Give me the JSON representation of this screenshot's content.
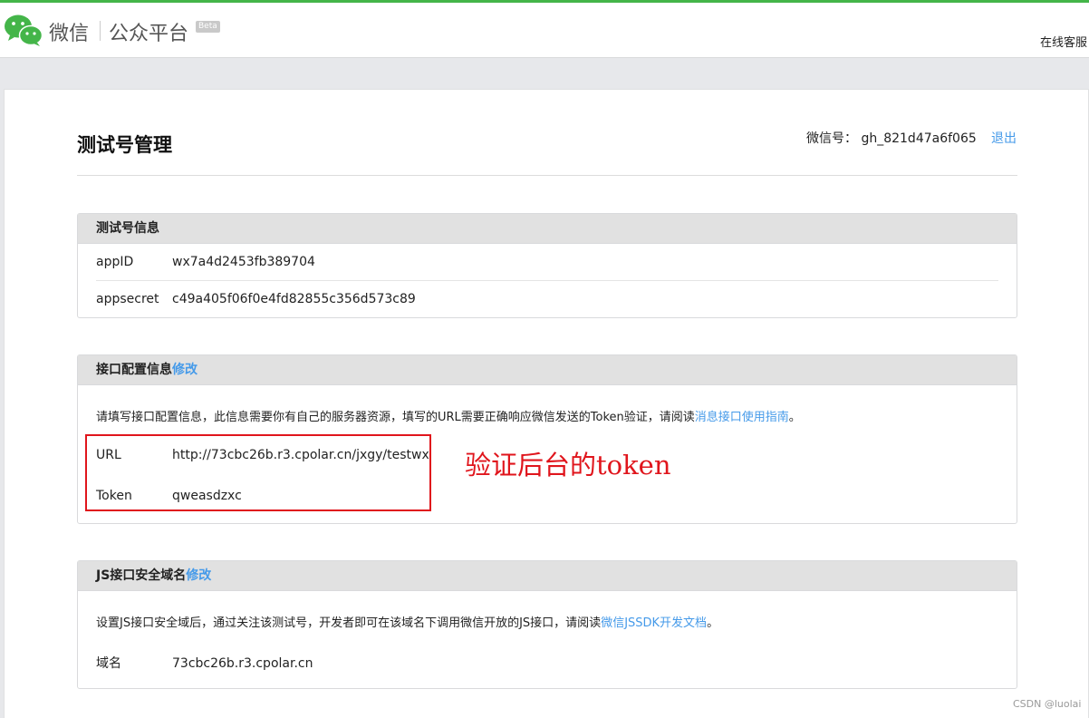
{
  "header": {
    "brand": "微信",
    "platform": "公众平台",
    "beta": "Beta",
    "service": "在线客服"
  },
  "page": {
    "title": "测试号管理",
    "account_label": "微信号： gh_821d47a6f065",
    "logout": "退出"
  },
  "test_info": {
    "title": "测试号信息",
    "rows": [
      {
        "key": "appID",
        "value": "wx7a4d2453fb389704"
      },
      {
        "key": "appsecret",
        "value": "c49a405f06f0e4fd82855c356d573c89"
      }
    ]
  },
  "interface": {
    "title": "接口配置信息",
    "edit": "修改",
    "desc": "请填写接口配置信息，此信息需要你有自己的服务器资源，填写的URL需要正确响应微信发送的Token验证，请阅读",
    "desc_link": "消息接口使用指南",
    "desc_end": "。",
    "rows": [
      {
        "key": "URL",
        "value": "http://73cbc26b.r3.cpolar.cn/jxgy/testwx"
      },
      {
        "key": "Token",
        "value": "qweasdzxc"
      }
    ]
  },
  "annotation": "验证后台的token",
  "js": {
    "title": "JS接口安全域名",
    "edit": "修改",
    "desc": "设置JS接口安全域后，通过关注该测试号，开发者即可在该域名下调用微信开放的JS接口，请阅读",
    "desc_link": "微信JSSDK开发文档",
    "desc_end": "。",
    "domain_key": "域名",
    "domain_value": "73cbc26b.r3.cpolar.cn"
  },
  "watermark": "CSDN @luolai",
  "colors": {
    "accent": "#44b549",
    "link": "#459ae9",
    "annotation": "#e0151c"
  }
}
